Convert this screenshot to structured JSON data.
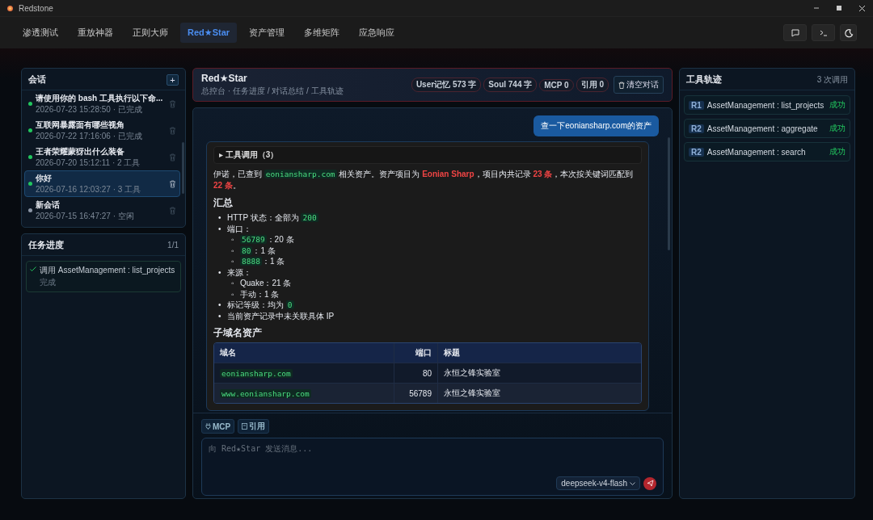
{
  "window": {
    "title": "Redstone"
  },
  "nav": {
    "tabs": [
      {
        "label": "渗透测试",
        "selected": false
      },
      {
        "label": "重放神器",
        "selected": false
      },
      {
        "label": "正则大师",
        "selected": false
      },
      {
        "label": "Red★Star",
        "selected": true
      },
      {
        "label": "资产管理",
        "selected": false
      },
      {
        "label": "多维矩阵",
        "selected": false
      },
      {
        "label": "应急响应",
        "selected": false
      }
    ]
  },
  "sessions": {
    "title": "会话",
    "add_label": "+",
    "items": [
      {
        "title": "请使用你的 bash 工具执行以下命...",
        "meta": "2026-07-23 15:28:50 · 已完成",
        "active": true,
        "selected": false
      },
      {
        "title": "互联网暴露面有哪些视角",
        "meta": "2026-07-22 17:16:06 · 已完成",
        "active": true,
        "selected": false
      },
      {
        "title": "王者荣耀蒙犽出什么装备",
        "meta": "2026-07-20 15:12:11 · 2 工具",
        "active": true,
        "selected": false
      },
      {
        "title": "你好",
        "meta": "2026-07-16 12:03:27 · 3 工具",
        "active": true,
        "selected": true
      },
      {
        "title": "新会话",
        "meta": "2026-07-15 16:47:27 · 空闲",
        "active": false,
        "selected": false
      }
    ]
  },
  "tasks": {
    "title": "任务进度",
    "count": "1/1",
    "items": [
      {
        "title": "调用 AssetManagement : list_projects",
        "state": "完成",
        "done": true
      }
    ]
  },
  "header": {
    "title": "Red★Star",
    "subtitle": "总控台 · 任务进度 / 对话总结 / 工具轨迹",
    "chips": [
      "User记忆 573 字",
      "Soul 744 字",
      "MCP 0",
      "引用 0"
    ],
    "clear_label": "清空对话"
  },
  "chat": {
    "user_message": "查一下eoniansharp.com的资产",
    "tool_calls": "▸ 工具调用（3）",
    "intro": [
      {
        "kind": "text",
        "text": "伊诺，已查到 "
      },
      {
        "kind": "code",
        "text": "eoniansharp.com"
      },
      {
        "kind": "text",
        "text": " 相关资产。资产项目为 "
      },
      {
        "kind": "hl",
        "text": "Eonian Sharp"
      },
      {
        "kind": "text",
        "text": "，项目内共记录 "
      },
      {
        "kind": "hl",
        "text": "23 条"
      },
      {
        "kind": "text",
        "text": "，本次按关键词匹配到 "
      },
      {
        "kind": "hl",
        "text": "22 条"
      },
      {
        "kind": "text",
        "text": "。"
      }
    ],
    "summary_heading": "汇总",
    "bullets": [
      {
        "marker": "•",
        "parts": [
          {
            "kind": "text",
            "text": "HTTP 状态：全部为 "
          },
          {
            "kind": "code",
            "text": "200"
          }
        ]
      },
      {
        "marker": "•",
        "parts": [
          {
            "kind": "text",
            "text": "端口："
          }
        ],
        "children": [
          {
            "marker": "◦",
            "parts": [
              {
                "kind": "code",
                "text": "56789"
              },
              {
                "kind": "text",
                "text": "：20 条"
              }
            ]
          },
          {
            "marker": "◦",
            "parts": [
              {
                "kind": "code",
                "text": "80"
              },
              {
                "kind": "text",
                "text": "：1 条"
              }
            ]
          },
          {
            "marker": "◦",
            "parts": [
              {
                "kind": "code",
                "text": "8888"
              },
              {
                "kind": "text",
                "text": "：1 条"
              }
            ]
          }
        ]
      },
      {
        "marker": "•",
        "parts": [
          {
            "kind": "text",
            "text": "来源："
          }
        ],
        "children": [
          {
            "marker": "◦",
            "parts": [
              {
                "kind": "text",
                "text": "Quake：21 条"
              }
            ]
          },
          {
            "marker": "◦",
            "parts": [
              {
                "kind": "text",
                "text": "手动：1 条"
              }
            ]
          }
        ]
      },
      {
        "marker": "•",
        "parts": [
          {
            "kind": "text",
            "text": "标记等级：均为 "
          },
          {
            "kind": "code",
            "text": "0"
          }
        ]
      },
      {
        "marker": "•",
        "parts": [
          {
            "kind": "text",
            "text": "当前资产记录中未关联具体 IP"
          }
        ]
      }
    ],
    "table_heading": "子域名资产",
    "table": {
      "columns": [
        "域名",
        "端口",
        "标题"
      ],
      "rows": [
        {
          "domain": "eoniansharp.com",
          "port": "80",
          "title": "永恒之锋实验室"
        },
        {
          "domain": "www.eoniansharp.com",
          "port": "56789",
          "title": "永恒之锋实验室"
        }
      ]
    }
  },
  "composer": {
    "toggles": [
      "MCP",
      "引用"
    ],
    "placeholder": "向 Red★Star 发送消息...",
    "model": "deepseek-v4-flash"
  },
  "trace": {
    "title": "工具轨迹",
    "count": "3 次调用",
    "items": [
      {
        "round": "R1",
        "call": "AssetManagement : list_projects",
        "status": "成功"
      },
      {
        "round": "R2",
        "call": "AssetManagement : aggregate",
        "status": "成功"
      },
      {
        "round": "R2",
        "call": "AssetManagement : search",
        "status": "成功"
      }
    ]
  }
}
